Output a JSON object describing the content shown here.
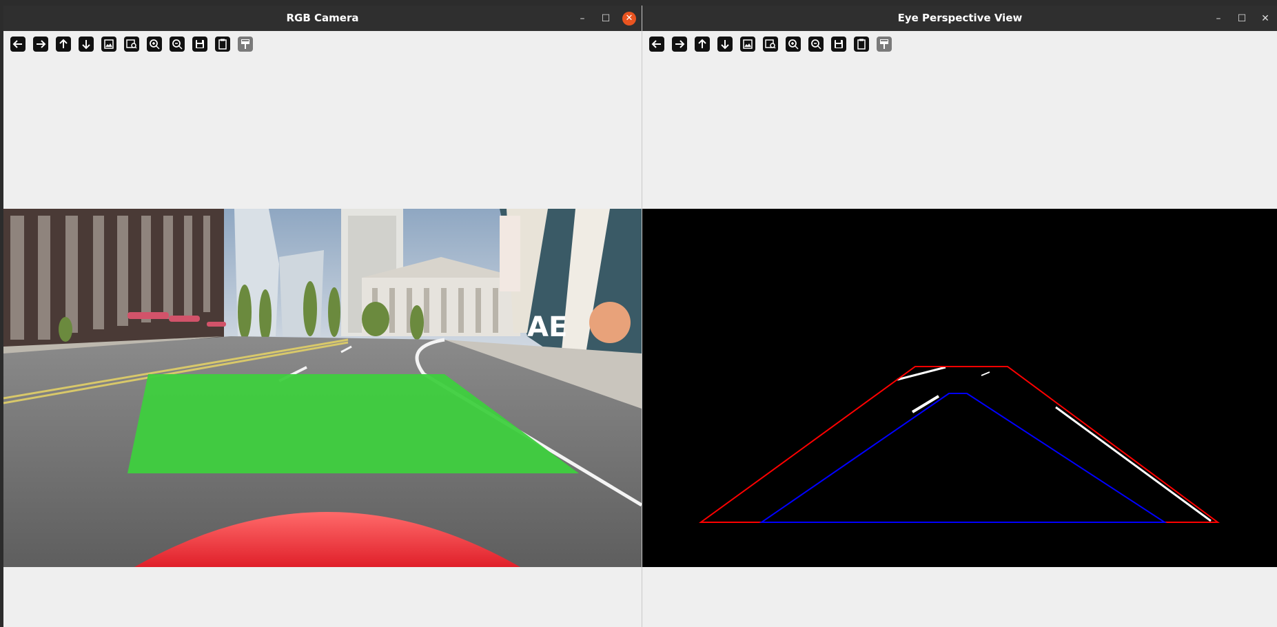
{
  "left_window": {
    "title": "RGB Camera",
    "controls": [
      "minimize",
      "maximize",
      "close"
    ],
    "toolbar": [
      {
        "name": "back",
        "icon": "arrow-left-icon"
      },
      {
        "name": "forward",
        "icon": "arrow-right-icon"
      },
      {
        "name": "up",
        "icon": "arrow-up-icon"
      },
      {
        "name": "down",
        "icon": "arrow-down-icon"
      },
      {
        "name": "image",
        "icon": "image-icon"
      },
      {
        "name": "image-search",
        "icon": "image-search-icon"
      },
      {
        "name": "zoom-in",
        "icon": "zoom-in-icon"
      },
      {
        "name": "zoom-out",
        "icon": "zoom-out-icon"
      },
      {
        "name": "save",
        "icon": "save-icon"
      },
      {
        "name": "clipboard",
        "icon": "clipboard-icon"
      },
      {
        "name": "paint",
        "icon": "paint-icon"
      }
    ]
  },
  "right_window": {
    "title": "Eye Perspective View",
    "controls": [
      "minimize",
      "maximize",
      "close"
    ],
    "toolbar": [
      {
        "name": "back",
        "icon": "arrow-left-icon"
      },
      {
        "name": "forward",
        "icon": "arrow-right-icon"
      },
      {
        "name": "up",
        "icon": "arrow-up-icon"
      },
      {
        "name": "down",
        "icon": "arrow-down-icon"
      },
      {
        "name": "image",
        "icon": "image-icon"
      },
      {
        "name": "image-search",
        "icon": "image-search-icon"
      },
      {
        "name": "zoom-in",
        "icon": "zoom-in-icon"
      },
      {
        "name": "zoom-out",
        "icon": "zoom-out-icon"
      },
      {
        "name": "save",
        "icon": "save-icon"
      },
      {
        "name": "clipboard",
        "icon": "clipboard-icon"
      },
      {
        "name": "paint",
        "icon": "paint-icon"
      }
    ]
  },
  "colors": {
    "titlebar": "#2f2f2f",
    "close_button": "#e95420",
    "lane_overlay": "#3ecf3e",
    "outer_roi": "#ff0000",
    "inner_roi": "#0000ff",
    "lane_marking": "#ffffff"
  }
}
